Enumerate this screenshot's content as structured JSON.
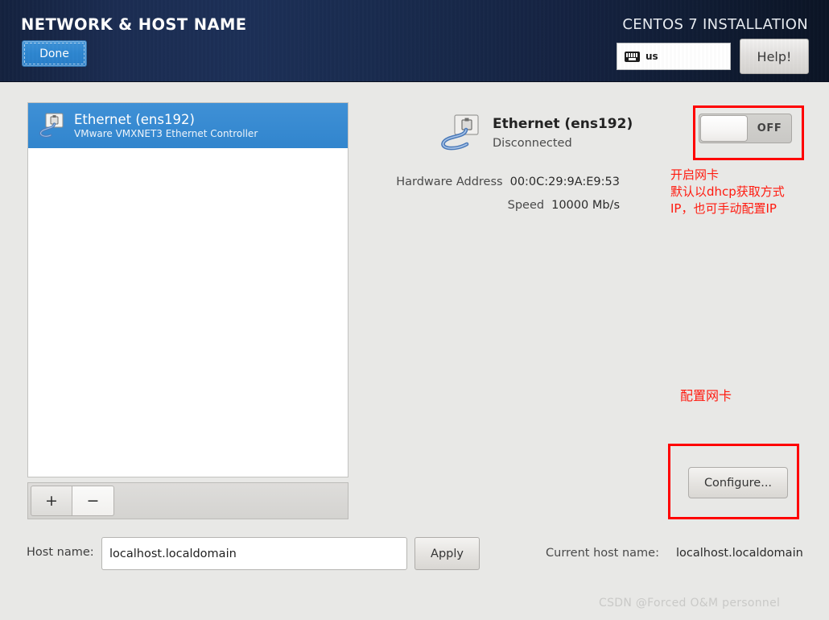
{
  "header": {
    "title": "NETWORK & HOST NAME",
    "done_label": "Done",
    "product": "CENTOS 7 INSTALLATION",
    "keyboard_layout": "us",
    "keyboard_icon": "keyboard-icon",
    "help_label": "Help!"
  },
  "device_list": {
    "items": [
      {
        "icon": "network-wall-jack-icon",
        "name": "Ethernet (ens192)",
        "description": "VMware VMXNET3 Ethernet Controller",
        "selected": true
      }
    ],
    "add_label": "+",
    "remove_label": "−"
  },
  "detail": {
    "icon": "network-wall-jack-icon",
    "name": "Ethernet (ens192)",
    "status": "Disconnected",
    "fields": [
      {
        "label": "Hardware Address",
        "value": "00:0C:29:9A:E9:53"
      },
      {
        "label": "Speed",
        "value": "10000 Mb/s"
      }
    ],
    "toggle_state": "OFF",
    "configure_label": "Configure..."
  },
  "annotations": {
    "accent_color": "#ff1a0f",
    "toggle_note": "开启网卡\n默认以dhcp获取方式\nIP，也可手动配置IP",
    "configure_note": "配置网卡"
  },
  "footer": {
    "host_name_label": "Host name:",
    "host_name_value": "localhost.localdomain",
    "host_name_placeholder": "localhost.localdomain",
    "apply_label": "Apply",
    "current_host_name_label": "Current host name:",
    "current_host_name_value": "localhost.localdomain"
  },
  "watermark": "CSDN @Forced O&M personnel"
}
